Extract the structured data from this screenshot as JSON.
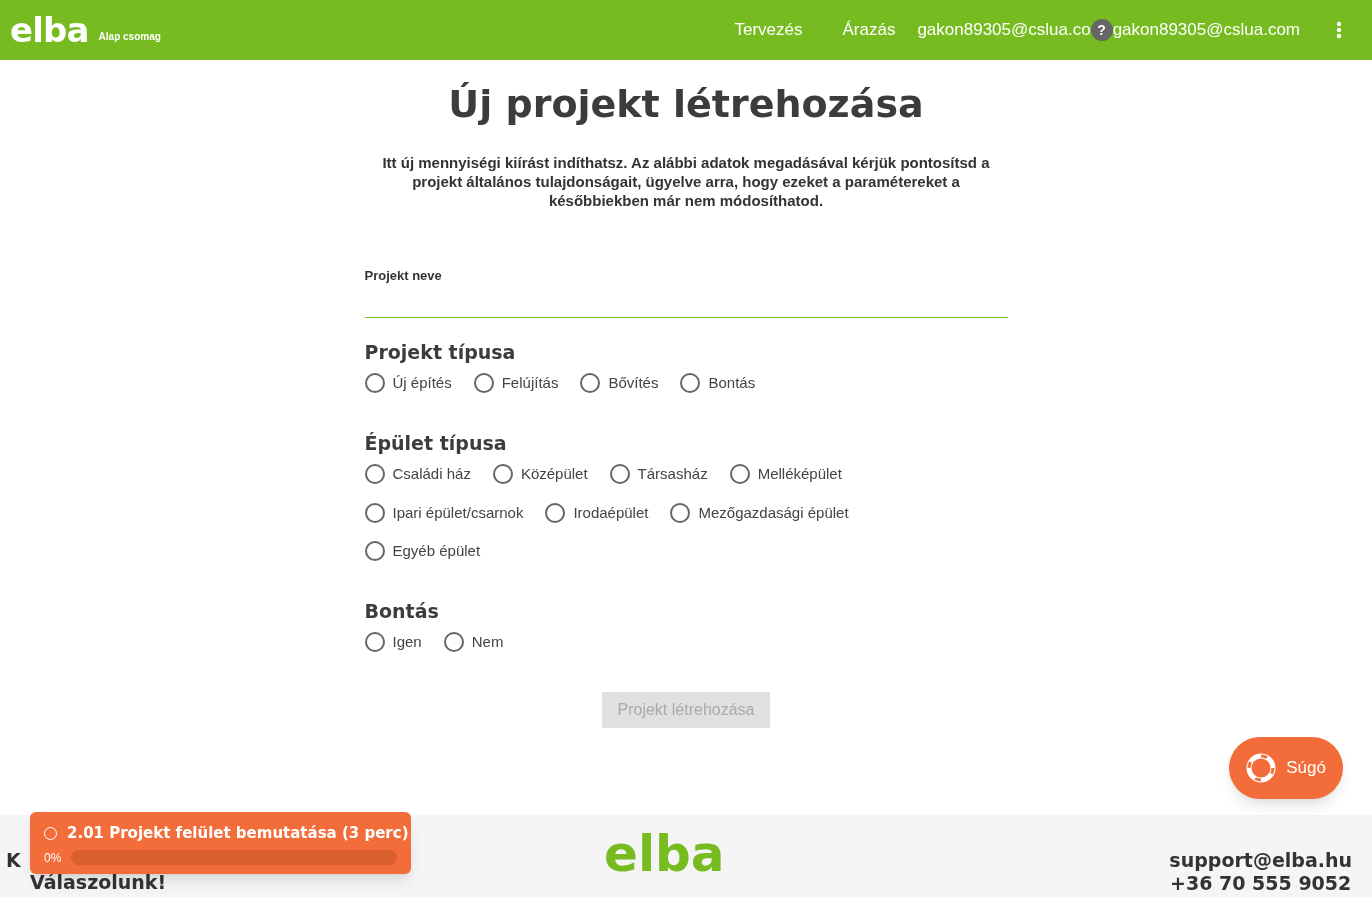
{
  "header": {
    "logo": "elba",
    "plan": "Alap csomag",
    "nav": [
      "Tervezés",
      "Árazás"
    ],
    "user_truncated": "gakon89305@cslua.co",
    "user": "gakon89305@cslua.com",
    "help_mark": "?"
  },
  "page": {
    "title": "Új projekt létrehozása",
    "intro": "Itt új mennyiségi kiírást indíthatsz. Az alábbi adatok megadásával kérjük pontosítsd a projekt általános tulajdonságait, ügyelve arra, hogy ezeket a paramétereket a későbbiekben már nem módosíthatod."
  },
  "name_field": {
    "label": "Projekt neve"
  },
  "groups": [
    {
      "title": "Projekt típusa",
      "options": [
        {
          "label": "Új építés",
          "selected": false
        },
        {
          "label": "Felújítás",
          "selected": false
        },
        {
          "label": "Bővítés",
          "selected": false
        },
        {
          "label": "Bontás",
          "selected": false
        }
      ]
    },
    {
      "title": "Épület típusa",
      "options": [
        {
          "label": "Családi ház",
          "selected": false
        },
        {
          "label": "Középület",
          "selected": false
        },
        {
          "label": "Társasház",
          "selected": false
        },
        {
          "label": "Melléképület",
          "selected": false
        },
        {
          "label": "Ipari épület/csarnok",
          "selected": false
        },
        {
          "label": "Irodaépület",
          "selected": false
        },
        {
          "label": "Mezőgazdasági épület",
          "selected": false
        },
        {
          "label": "Egyéb épület",
          "selected": false
        }
      ]
    },
    {
      "title": "Bontás",
      "options": [
        {
          "label": "Igen",
          "selected": false
        },
        {
          "label": "Nem",
          "selected": false
        }
      ]
    }
  ],
  "submit": {
    "label": "Projekt létrehozása",
    "disabled": true
  },
  "help_button": {
    "label": "Súgó"
  },
  "toast": {
    "title": "2.01 Projekt felület bemutatása (3 perc)",
    "done": false,
    "percent": "0%",
    "level": 0
  },
  "footer": {
    "left": [
      "K",
      "Válaszolunk!"
    ],
    "logo": "elba",
    "contact": [
      "support@elba.hu",
      "+36 70 555 9052"
    ]
  }
}
